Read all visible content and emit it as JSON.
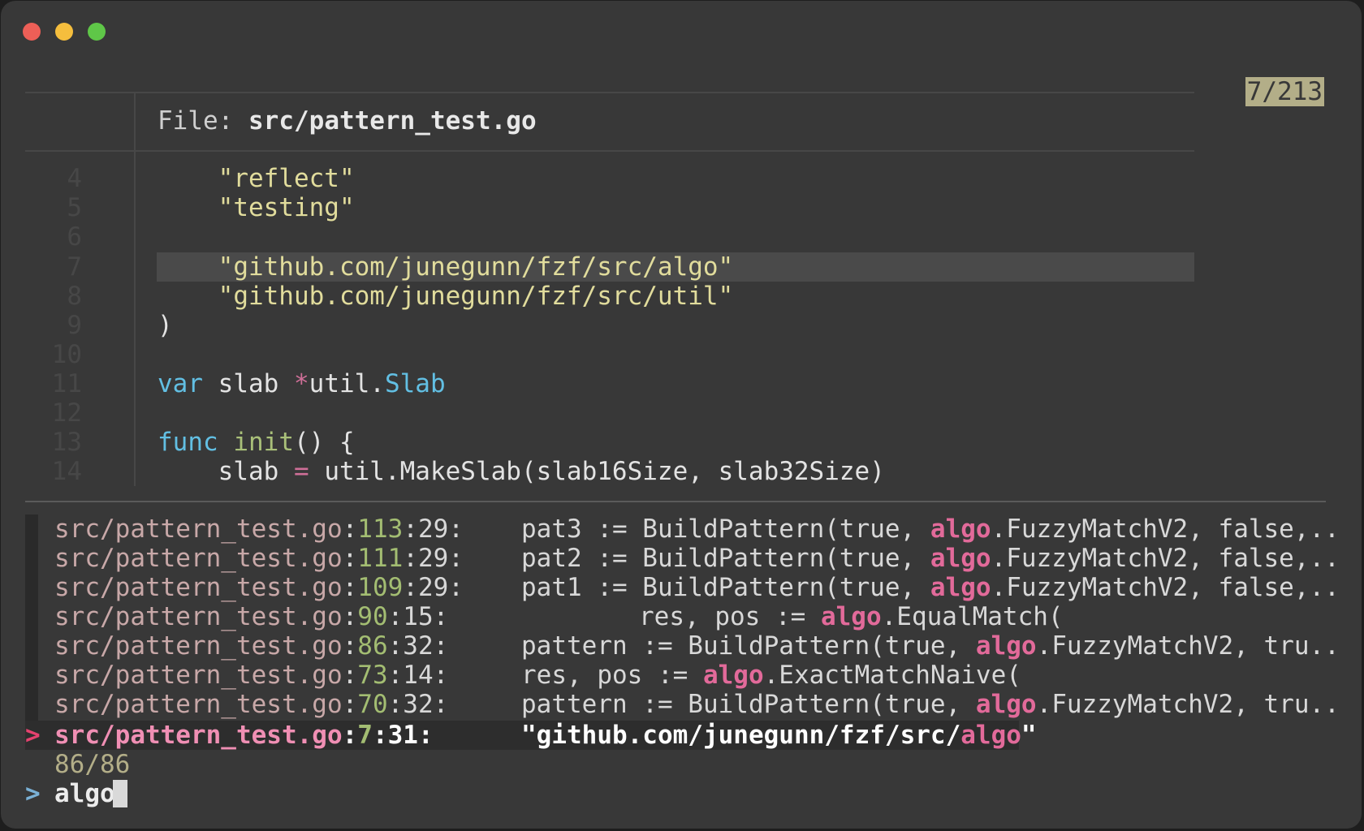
{
  "window": {
    "controls": [
      "close",
      "minimize",
      "zoom"
    ]
  },
  "preview": {
    "counter": "7/213",
    "file_label": "File:",
    "file_path": "src/pattern_test.go",
    "line_numbers": [
      "4",
      "5",
      "6",
      "7",
      "8",
      "9",
      "10",
      "11",
      "12",
      "13",
      "14"
    ],
    "code": {
      "l4": "\"reflect\"",
      "l5": "\"testing\"",
      "l7": "\"github.com/junegunn/fzf/src/algo\"",
      "l8": "\"github.com/junegunn/fzf/src/util\"",
      "l9": ")",
      "l11_kw": "var",
      "l11_mid": " slab ",
      "l11_star": "*",
      "l11_pkg": "util.",
      "l11_type": "Slab",
      "l13_kw": "func",
      "l13_sp": " ",
      "l13_fn": "init",
      "l13_rest": "() {",
      "l14_a": "slab ",
      "l14_op": "=",
      "l14_b": " util.MakeSlab(slab16Size, slab32Size)"
    }
  },
  "results": [
    {
      "path": "src/pattern_test.go",
      "line": "113",
      "col": "29",
      "pre": "pat3 := BuildPattern(true, ",
      "match": "algo",
      "post": ".FuzzyMatchV2, false,.."
    },
    {
      "path": "src/pattern_test.go",
      "line": "111",
      "col": "29",
      "pre": "pat2 := BuildPattern(true, ",
      "match": "algo",
      "post": ".FuzzyMatchV2, false,.."
    },
    {
      "path": "src/pattern_test.go",
      "line": "109",
      "col": "29",
      "pre": "pat1 := BuildPattern(true, ",
      "match": "algo",
      "post": ".FuzzyMatchV2, false,.."
    },
    {
      "path": "src/pattern_test.go",
      "line": "90",
      "col": "15",
      "pre": "res, pos := ",
      "match": "algo",
      "post": ".EqualMatch("
    },
    {
      "path": "src/pattern_test.go",
      "line": "86",
      "col": "32",
      "pre": "pattern := BuildPattern(true, ",
      "match": "algo",
      "post": ".FuzzyMatchV2, tru.."
    },
    {
      "path": "src/pattern_test.go",
      "line": "73",
      "col": "14",
      "pre": "res, pos := ",
      "match": "algo",
      "post": ".ExactMatchNaive("
    },
    {
      "path": "src/pattern_test.go",
      "line": "70",
      "col": "32",
      "pre": "pattern := BuildPattern(true, ",
      "match": "algo",
      "post": ".FuzzyMatchV2, tru.."
    },
    {
      "path": "src/pattern_test.go",
      "line": "7",
      "col": "31",
      "pre": "\"github.com/junegunn/fzf/src/",
      "match": "algo",
      "post": "\""
    }
  ],
  "selection_marker": ">",
  "match_count": "86/86",
  "prompt": ">",
  "query": "algo",
  "colors": {
    "background": "#383838",
    "match": "#e26a9a",
    "line_number": "#a3bd72",
    "string": "#e1dc9c",
    "keyword": "#62bfe3"
  }
}
